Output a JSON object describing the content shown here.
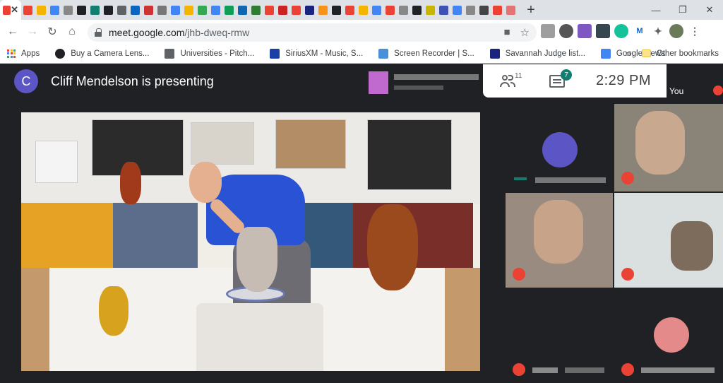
{
  "browser": {
    "url_host": "meet.google.com",
    "url_path": "/jhb-dweq-rmw",
    "tab_close_glyph": "✕",
    "new_tab_glyph": "+",
    "tab_favicons": [
      "#ea4335",
      "#f4b400",
      "#4285f4",
      "#888888",
      "#202124",
      "#137e6f",
      "#202124",
      "#5f6368",
      "#0a66c2",
      "#cc3333",
      "#777777",
      "#4285f4",
      "#f4b400",
      "#34a853",
      "#4285f4",
      "#0f9d58",
      "#0f67b1",
      "#2e7d32",
      "#ea4335",
      "#cc2222",
      "#ea4335",
      "#1a237e",
      "#f7931a",
      "#202124",
      "#ea4335",
      "#f4b400",
      "#4285f4",
      "#ea4335",
      "#888888",
      "#202124",
      "#c9b600",
      "#3f51b5",
      "#4285f4",
      "#888888",
      "#444444",
      "#ea4335",
      "#e57373"
    ]
  },
  "bookmarks": {
    "items": [
      {
        "label": "Apps",
        "icon": "apps-grid-icon",
        "color": "#4285f4"
      },
      {
        "label": "Buy a Camera Lens...",
        "icon": "camera-icon",
        "color": "#202124"
      },
      {
        "label": "Universities - Pitch...",
        "icon": "universities-icon",
        "color": "#5f6368"
      },
      {
        "label": "SiriusXM - Music, S...",
        "icon": "siriusxm-icon",
        "color": "#1a3fa6"
      },
      {
        "label": "Screen Recorder | S...",
        "icon": "screen-recorder-icon",
        "color": "#4a90d9"
      },
      {
        "label": "Savannah Judge list...",
        "icon": "savannah-icon",
        "color": "#1a237e"
      },
      {
        "label": "Google News",
        "icon": "google-news-icon",
        "color": "#4285f4"
      }
    ],
    "more": "»",
    "other": "Other bookmarks"
  },
  "meet": {
    "presenter_initial": "C",
    "presenting_text": "Cliff Mendelson is presenting",
    "people_count": "11",
    "chat_count": "7",
    "time": "2:29  PM",
    "you_label": "You"
  },
  "colors": {
    "meet_bg": "#202124",
    "avatar": "#5c55c5",
    "chat_badge": "#137e6f",
    "muted_mic": "#ea4335"
  }
}
